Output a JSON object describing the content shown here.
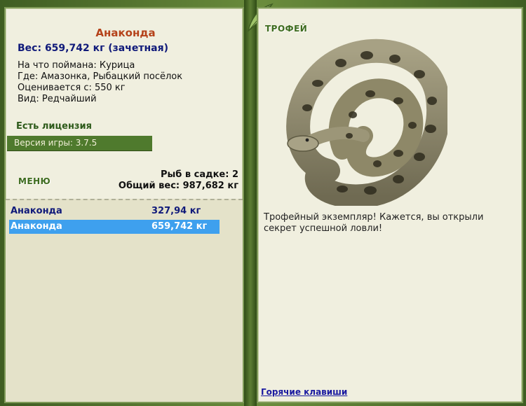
{
  "fish": {
    "name": "Анаконда",
    "weight_line": "Вес: 659,742 кг (зачетная)",
    "bait_line": "На что поймана: Курица",
    "place_line": "Где: Амазонка, Рыбацкий посёлок",
    "price_line": "Оценивается с: 550 кг",
    "kind_line": "Вид: Редчайший"
  },
  "license_text": "Есть лицензия",
  "version_text": "Версия игры: 3.7.5",
  "menu_label": "МЕНЮ",
  "keepnet": {
    "count_line": "Рыб в садке: 2",
    "total_line": "Общий вес: 987,682 кг"
  },
  "catch_list": [
    {
      "name": "Анаконда",
      "weight": "327,94 кг"
    },
    {
      "name": "Анаконда",
      "weight": "659,742 кг"
    }
  ],
  "trophy": {
    "title": "ТРОФЕЙ",
    "text": "Трофейный экземпляр! Кажется, вы открыли секрет успешной ловли!",
    "hotkeys": "Горячие клавиши"
  },
  "colors": {
    "frame": "#4b6a2a",
    "panel": "#f0efdf",
    "selected_row": "#3ea0ee",
    "name_color": "#b5421a",
    "weight_color": "#101a7a"
  }
}
